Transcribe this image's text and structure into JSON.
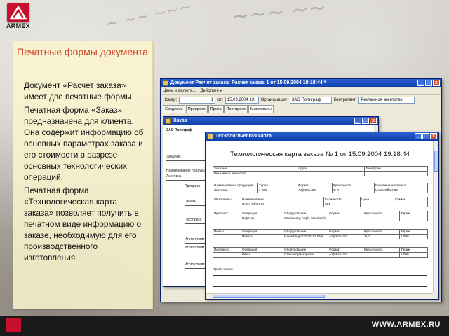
{
  "brand": {
    "logo_text": "ARMEX",
    "footer_url": "WWW.ARMEX.RU"
  },
  "slide": {
    "title": "Печатные формы документа",
    "paragraphs": [
      "Документ «Расчет заказа» имеет две печатные формы.",
      "Печатная форма «Заказ» предназначена для клиента. Она содержит информацию об основных параметрах заказа и его стоимости в разрезе основных технологических операций.",
      "Печатная форма «Технологическая карта заказа» позволяет получить в печатном виде информацию о заказе, необходимую для его производственного изготовления."
    ]
  },
  "doc_window": {
    "title": "Документ Расчет заказа: Расчет заказа 1 от 15.09.2004 19:18:44 *",
    "menu": [
      "Цены и валюта...",
      "Действия ▾"
    ],
    "fields": {
      "number_label": "Номер:",
      "number_value": "1",
      "date_label": "от:",
      "date_value": "15.09.2004 19:",
      "org_label": "Организация:",
      "org_value": "ЗАО Полиграф",
      "contractor_label": "Контрагент:",
      "contractor_value": "Рекламное агентство"
    },
    "tabs": [
      "Сведения",
      "Препресс",
      "Пресс",
      "Постпресс",
      "Материалы"
    ]
  },
  "order_window": {
    "title": "Заказ",
    "company": "ЗАО Полиграф",
    "labels": [
      "Заказчик",
      "Наименование продукции",
      "Листовка",
      "Препресс",
      "Печать",
      "Постпресс",
      "Итого стоим",
      "Итого стоим",
      "Итого стоим"
    ]
  },
  "tech_window": {
    "title": "Технологическая карта",
    "heading": "Технологическая карта заказа № 1 от 15.09.2004 19:18:44",
    "client_table": {
      "headers": [
        "Заказчик",
        "Адрес",
        "Телефоны"
      ],
      "row": [
        "Рекламное агентство",
        "",
        ""
      ]
    },
    "product_table": {
      "headers": [
        "Наименование продукции",
        "Тираж",
        "Формат",
        "Красочность",
        "Печатный материал"
      ],
      "row": [
        "Листовка",
        "1 000",
        "A2(594х420)",
        "1+0",
        "Union Offset 80"
      ]
    },
    "materials_table": {
      "label": "Материалы",
      "headers": [
        "Наименование",
        "Количество",
        "Цена",
        "Сумма"
      ],
      "row": [
        "Union Offset 80",
        "324",
        "",
        ""
      ]
    },
    "prepress_table": {
      "label": "Препресс",
      "headers": [
        "Операция",
        "Оборудование",
        "Формат",
        "Красочность",
        "Тираж"
      ],
      "row": [
        "Верстка",
        "Компьютер Apple Macintosh",
        "",
        "",
        ""
      ]
    },
    "press_table": {
      "label": "Печать",
      "headers": [
        "Операция",
        "Оборудование",
        "Формат",
        "Красочность",
        "Тираж"
      ],
      "row": [
        "Печать",
        "Heidelberg GTOVP 52 Plus",
        "A2(594х420)",
        "1+0",
        "1 000"
      ]
    },
    "postpress_table": {
      "label": "Постпресс",
      "headers": [
        "Операция",
        "Оборудование",
        "Формат",
        "Красочность",
        "Тираж"
      ],
      "row": [
        "Резка",
        "Станок бумагорезки",
        "A2(594х420)",
        "",
        "1 000"
      ]
    },
    "notes_label": "Примечание:"
  }
}
